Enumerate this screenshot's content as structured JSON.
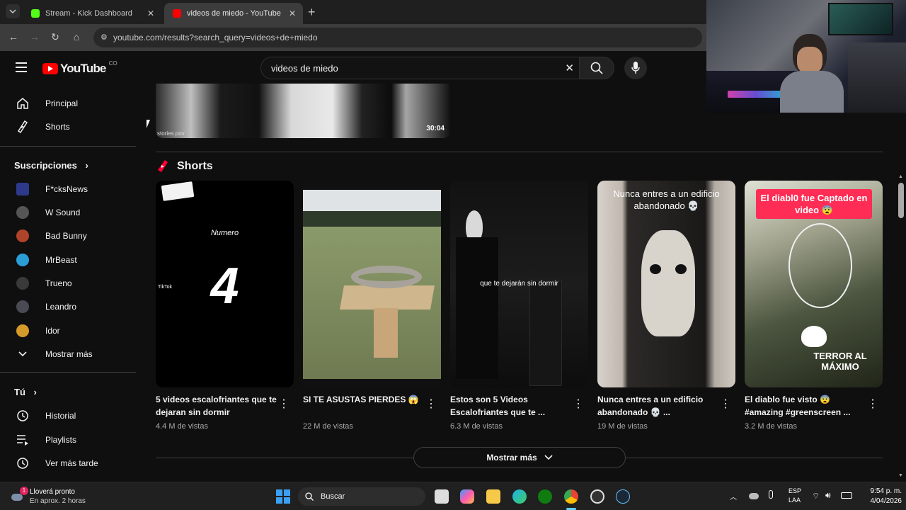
{
  "tabs": [
    {
      "label": "Stream - Kick Dashboard",
      "favicon_color": "#53fc18"
    },
    {
      "label": "videos de miedo - YouTube",
      "favicon_color": "#ff0000"
    }
  ],
  "address": {
    "url": "youtube.com/results?search_query=videos+de+miedo"
  },
  "youtube": {
    "logo": "YouTube",
    "country": "CO"
  },
  "search": {
    "query": "videos de miedo"
  },
  "sidebar": {
    "top_items": [
      {
        "label": "Principal",
        "icon": "home-icon"
      },
      {
        "label": "Shorts",
        "icon": "shorts-icon"
      }
    ],
    "subscriptions_heading": "Suscripciones",
    "subscriptions": [
      {
        "label": "F*cksNews",
        "color": "#2d3a8c"
      },
      {
        "label": "W Sound",
        "color": "#555555"
      },
      {
        "label": "Bad Bunny",
        "color": "#b0442a"
      },
      {
        "label": "MrBeast",
        "color": "#2a9fd6"
      },
      {
        "label": "Trueno",
        "color": "#3a3a3a"
      },
      {
        "label": "Leandro",
        "color": "#4a4a55"
      },
      {
        "label": "Idor",
        "color": "#d49a2a"
      }
    ],
    "more_label": "Mostrar más",
    "you_heading": "Tú",
    "you_items": [
      {
        "label": "Historial",
        "icon": "history-icon"
      },
      {
        "label": "Playlists",
        "icon": "playlists-icon"
      },
      {
        "label": "Ver más tarde",
        "icon": "watch-later-icon"
      }
    ]
  },
  "video": {
    "duration": "30:04",
    "watermark": "stories pov"
  },
  "shorts": {
    "heading": "Shorts",
    "items": [
      {
        "title": "5 videos escalofriantes que te dejaran sin dormir",
        "views": "4.4 M de vistas",
        "overlay_top": "Numero",
        "overlay_big": "4",
        "badge": "TikTok"
      },
      {
        "title": "SI TE ASUSTAS PIERDES 😱",
        "views": "22 M de vistas"
      },
      {
        "title": "Estos son 5 Videos Escalofriantes que te ...",
        "views": "6.3 M de vistas",
        "overlay": "que te dejarán sin dormir"
      },
      {
        "title": "Nunca entres a un edificio abandonado 💀 ...",
        "views": "19 M de vistas",
        "overlay": "Nunca entres a un edificio abandonado 💀"
      },
      {
        "title": "El diablo fue visto 😨 #amazing #greenscreen ...",
        "views": "3.2 M de vistas",
        "overlay": "El diabl0 fue Captado en video 😨",
        "overlay_bottom": "TERROR AL MÁXIMO"
      }
    ],
    "show_more": "Mostrar más"
  },
  "taskbar": {
    "weather_title": "Lloverá pronto",
    "weather_sub": "En aprox. 2 horas",
    "weather_badge": "1",
    "search_label": "Buscar",
    "lang_top": "ESP",
    "lang_bottom": "LAA",
    "time": "9:54 p. m.",
    "date": "4/04/2026"
  }
}
